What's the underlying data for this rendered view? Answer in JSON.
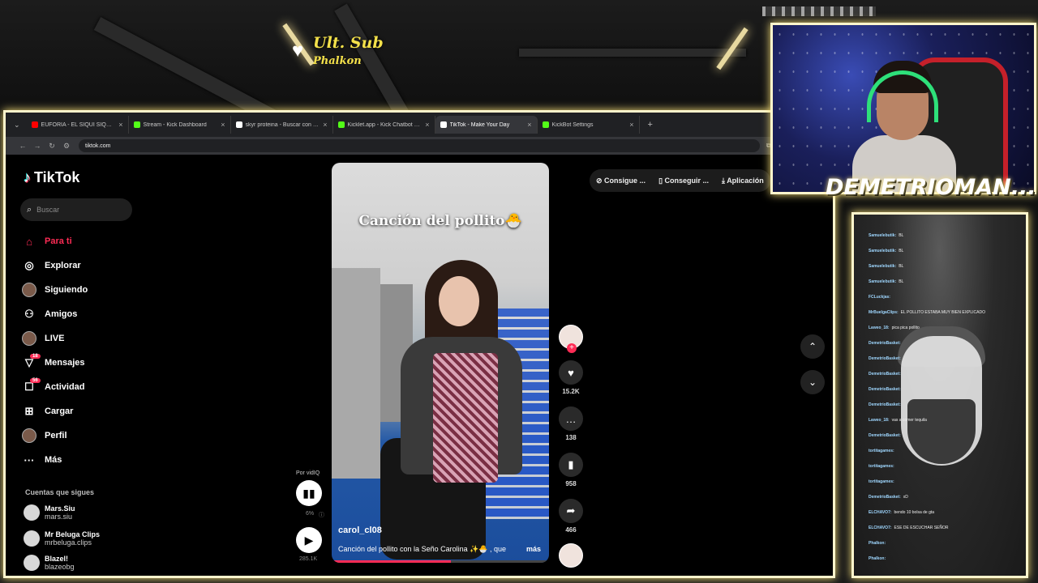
{
  "overlay": {
    "sub_title": "Ult. Sub",
    "sub_name": "Phalkon",
    "streamer_name": "DEMETRIOMAN..."
  },
  "browser": {
    "tabs": [
      {
        "label": "EUFORIA - EL SIQUI SIQUI VID",
        "favicon_color": "#ff0000",
        "active": false
      },
      {
        "label": "Stream - Kick Dashboard",
        "favicon_color": "#53fc18",
        "active": false
      },
      {
        "label": "skyr proteina - Buscar con Goo",
        "favicon_color": "#ffffff",
        "active": false
      },
      {
        "label": "Kicklet.app - Kick Chatbot and",
        "favicon_color": "#53fc18",
        "active": false
      },
      {
        "label": "TikTok - Make Your Day",
        "favicon_color": "#ffffff",
        "active": true
      },
      {
        "label": "KickBot Settings",
        "favicon_color": "#53fc18",
        "active": false
      }
    ],
    "url": "tiktok.com"
  },
  "tiktok": {
    "logo": "TikTok",
    "search_placeholder": "Buscar",
    "nav": [
      {
        "label": "Para ti",
        "icon": "home-icon",
        "active": true
      },
      {
        "label": "Explorar",
        "icon": "compass-icon"
      },
      {
        "label": "Siguiendo",
        "icon": "following-avatar-icon"
      },
      {
        "label": "Amigos",
        "icon": "friends-icon"
      },
      {
        "label": "LIVE",
        "icon": "live-icon"
      },
      {
        "label": "Mensajes",
        "icon": "messages-icon",
        "badge": "18"
      },
      {
        "label": "Actividad",
        "icon": "activity-icon",
        "badge": "56"
      },
      {
        "label": "Cargar",
        "icon": "upload-icon"
      },
      {
        "label": "Perfil",
        "icon": "profile-icon"
      },
      {
        "label": "Más",
        "icon": "more-icon"
      }
    ],
    "following_title": "Cuentas que sigues",
    "following": [
      {
        "name": "Mars.Siu",
        "handle": "mars.siu"
      },
      {
        "name": "Mr Beluga Clips",
        "handle": "mrbeluga.clips"
      },
      {
        "name": "Blazel!",
        "handle": "blazeobg"
      }
    ],
    "top_actions": [
      "Consigue ...",
      "Conseguir ...",
      "Aplicación"
    ],
    "video": {
      "overlay_title": "Canción del pollito🐣",
      "username": "carol_cl08",
      "description": "Canción del pollito con la Seño Carolina ✨🐣 , que",
      "more": "más",
      "progress": 0.55
    },
    "vidiq": {
      "label": "Por vidIQ",
      "percent": "6%",
      "views": "285.1K"
    },
    "actions": {
      "likes": "15.2K",
      "comments": "138",
      "saves": "958",
      "shares": "466"
    }
  },
  "chat": {
    "messages": [
      {
        "user": "Samuelebutik:",
        "text": "BL"
      },
      {
        "user": "Samuelebutik:",
        "text": "BL"
      },
      {
        "user": "Samuelebutik:",
        "text": "BL"
      },
      {
        "user": "Samuelebutik:",
        "text": "BL"
      },
      {
        "user": "FCLuckjas:",
        "text": ""
      },
      {
        "user": "MrBuelgaClips:",
        "text": "EL POLLITO ESTABA MUY BIEN EXPLICADO"
      },
      {
        "user": "Laweo_18:",
        "text": "pica pica pollito"
      },
      {
        "user": "DemetrioBasket:",
        "text": ""
      },
      {
        "user": "DemetrioBasket:",
        "text": ""
      },
      {
        "user": "DemetrioBasket:",
        "text": ""
      },
      {
        "user": "DemetrioBasket:",
        "text": ""
      },
      {
        "user": "DemetrioBasket:",
        "text": ""
      },
      {
        "user": "Laweo_18:",
        "text": "vas a comer tequila"
      },
      {
        "user": "DemetrioBasket:",
        "text": ""
      },
      {
        "user": "tortitagames:",
        "text": ""
      },
      {
        "user": "tortitagames:",
        "text": ""
      },
      {
        "user": "tortitagames:",
        "text": ""
      },
      {
        "user": "DemetrioBasket:",
        "text": "xD"
      },
      {
        "user": "ELCHAVO7:",
        "text": "bendo 10 bolsa de gta"
      },
      {
        "user": "ELCHAVO7:",
        "text": "ESE DE ESCUCHAR SEÑOR"
      },
      {
        "user": "Phalkon:",
        "text": ""
      },
      {
        "user": "Phalkon:",
        "text": ""
      }
    ]
  }
}
